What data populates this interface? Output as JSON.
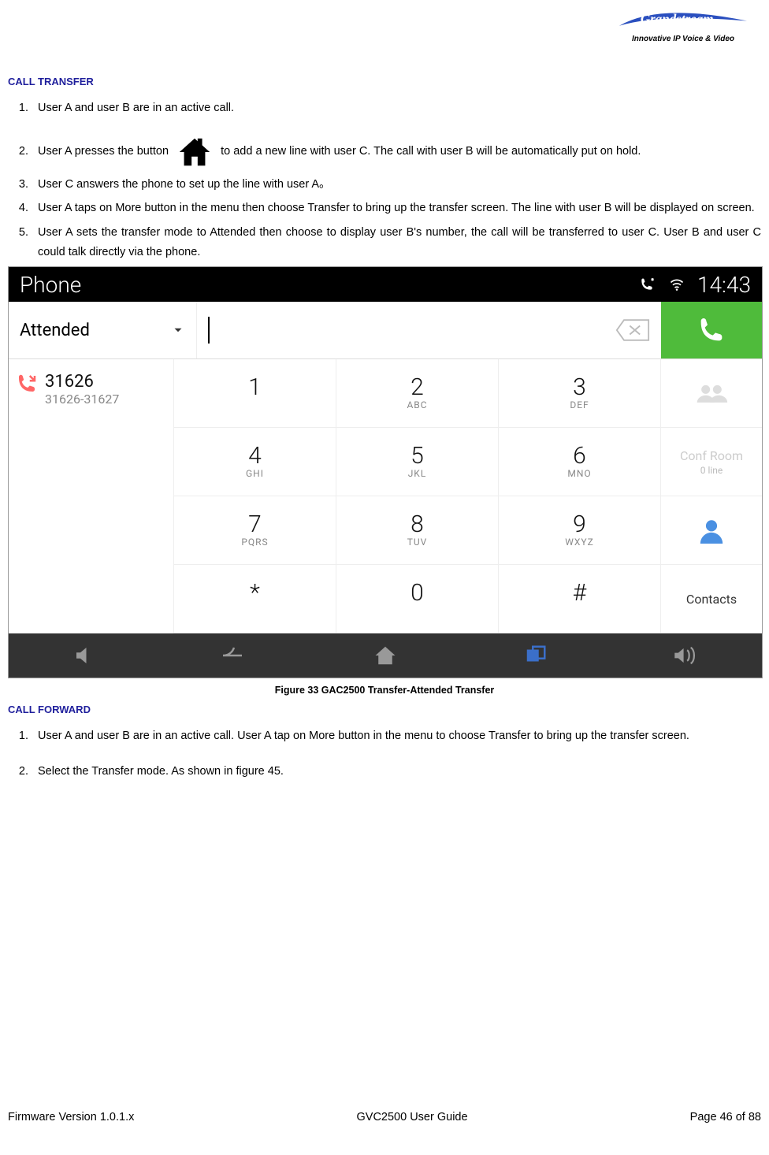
{
  "logo": {
    "brand": "Grandstream",
    "tagline": "Innovative IP Voice & Video"
  },
  "headings": {
    "transfer": "CALL TRANSFER",
    "forward": "CALL FORWARD"
  },
  "transfer_steps": [
    "User A and user B are in an active call.",
    "User A presses the button |HOME| to add a new line with user C. The call with user B will be automatically put on hold.",
    "User C answers the phone to set up the line with user A。",
    "User A taps on More button in the menu then choose Transfer to bring up the transfer screen. The line with user B will be displayed on screen.",
    "User A sets the transfer mode to Attended then choose to display user B's number, the call will be transferred to user C. User B and user C could talk directly via the phone."
  ],
  "forward_steps": [
    "User A and user B are in an active call. User A tap on More button in the menu to choose Transfer to bring up the transfer screen.",
    "Select the Transfer mode. As shown in figure 45."
  ],
  "figure": {
    "caption": "Figure 33 GAC2500 Transfer-Attended Transfer"
  },
  "phone": {
    "statusbar": {
      "app": "Phone",
      "time": "14:43"
    },
    "mode": "Attended",
    "entry": {
      "number": "31626",
      "sub": "31626-31627"
    },
    "keys": [
      {
        "k1": "1",
        "k2": ""
      },
      {
        "k1": "2",
        "k2": "ABC"
      },
      {
        "k1": "3",
        "k2": "DEF"
      },
      {
        "k1": "4",
        "k2": "GHI"
      },
      {
        "k1": "5",
        "k2": "JKL"
      },
      {
        "k1": "6",
        "k2": "MNO"
      },
      {
        "k1": "7",
        "k2": "PQRS"
      },
      {
        "k1": "8",
        "k2": "TUV"
      },
      {
        "k1": "9",
        "k2": "WXYZ"
      },
      {
        "k1": "*",
        "k2": ""
      },
      {
        "k1": "0",
        "k2": ""
      },
      {
        "k1": "#",
        "k2": ""
      }
    ],
    "right": {
      "conf": "Conf Room",
      "conf_sub": "0 line",
      "contacts": "Contacts"
    }
  },
  "footer": {
    "left": "Firmware Version 1.0.1.x",
    "center": "GVC2500 User Guide",
    "right": "Page 46 of 88"
  }
}
